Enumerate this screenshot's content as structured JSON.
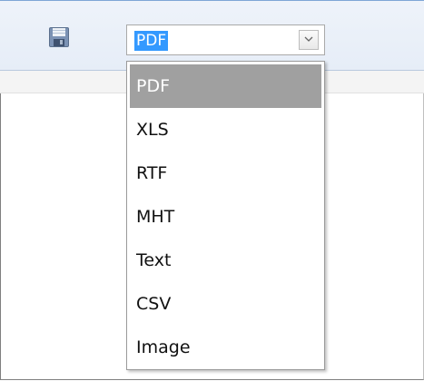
{
  "toolbar": {
    "save_icon": "save-icon",
    "format_select": {
      "value": "PDF",
      "arrow_icon": "chevron-down-icon"
    }
  },
  "dropdown": {
    "options": [
      {
        "label": "PDF",
        "selected": true
      },
      {
        "label": "XLS",
        "selected": false
      },
      {
        "label": "RTF",
        "selected": false
      },
      {
        "label": "MHT",
        "selected": false
      },
      {
        "label": "Text",
        "selected": false
      },
      {
        "label": "CSV",
        "selected": false
      },
      {
        "label": "Image",
        "selected": false
      }
    ]
  },
  "colors": {
    "selection_highlight": "#3399ff",
    "hovered_option": "#a0a0a0",
    "toolbar_bg": "#e9eff8"
  }
}
